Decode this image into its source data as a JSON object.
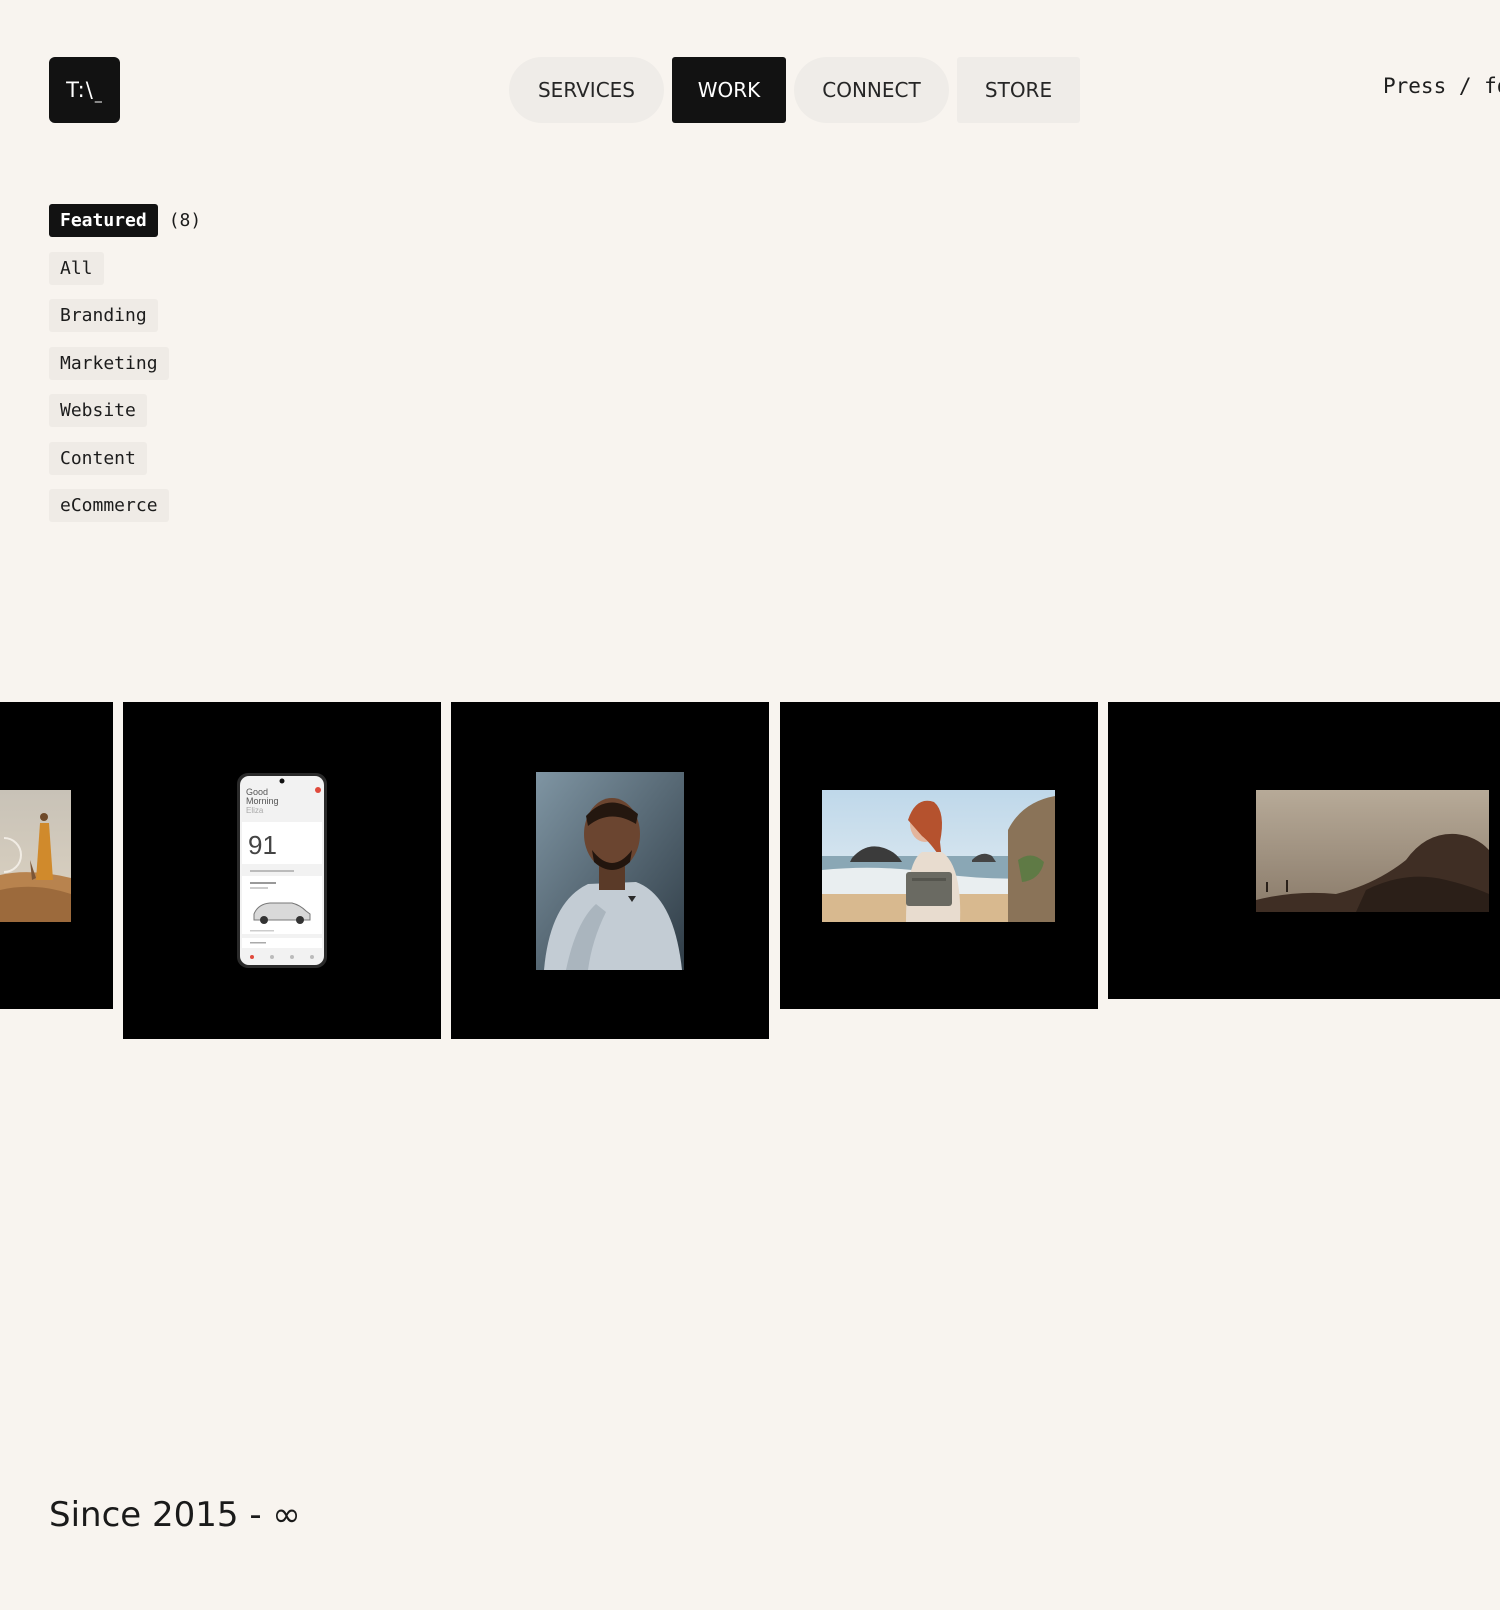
{
  "header": {
    "logo_text": "T:\\",
    "logo_cursor": "_",
    "nav": [
      {
        "label": "SERVICES"
      },
      {
        "label": "WORK"
      },
      {
        "label": "CONNECT"
      },
      {
        "label": "STORE"
      }
    ],
    "active_nav": "WORK",
    "press_hint": "Press / for"
  },
  "filters": {
    "items": [
      {
        "label": "Featured",
        "count": "(8)"
      },
      {
        "label": "All"
      },
      {
        "label": "Branding"
      },
      {
        "label": "Marketing"
      },
      {
        "label": "Website"
      },
      {
        "label": "Content"
      },
      {
        "label": "eCommerce"
      }
    ],
    "active": "Featured"
  },
  "gallery": {
    "phone_greeting_line1": "Good",
    "phone_greeting_line2": "Morning",
    "phone_name": "Eliza",
    "phone_value": "91"
  },
  "footer": {
    "since": "Since 2015 - ∞"
  },
  "colors": {
    "background": "#f8f4ef",
    "dark": "#121212",
    "chip": "#efebe6"
  }
}
